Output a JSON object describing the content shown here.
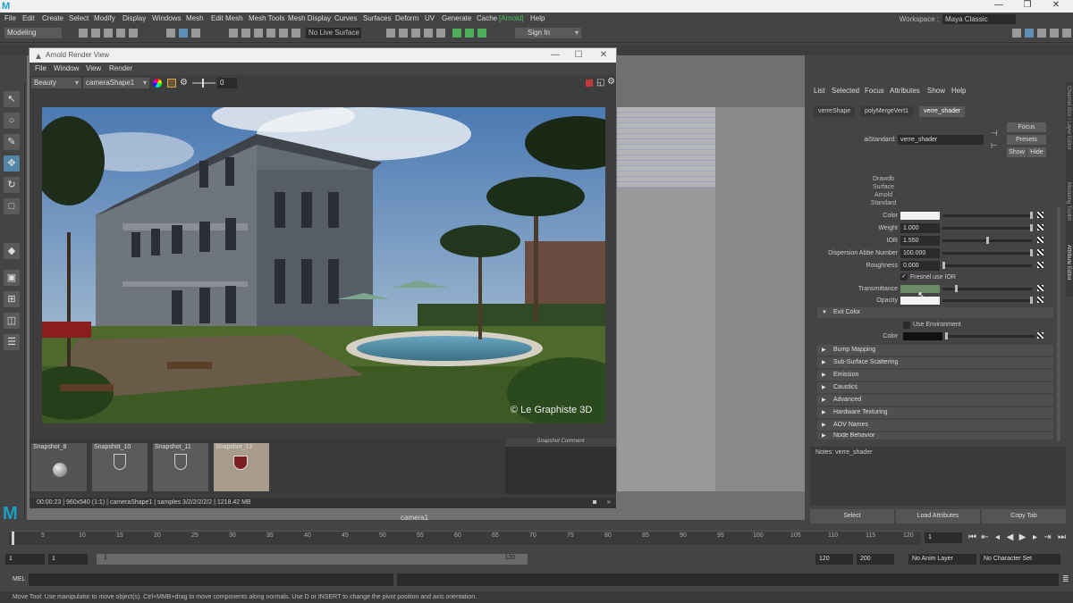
{
  "app": {
    "logo": "M",
    "workspace_label": "Workspace :",
    "workspace": "Maya Classic"
  },
  "menubar": [
    "File",
    "Edit",
    "Create",
    "Select",
    "Modify",
    "Display",
    "Windows",
    "Mesh",
    "Edit Mesh",
    "Mesh Tools",
    "Mesh Display",
    "Curves",
    "Surfaces",
    "Deform",
    "UV",
    "Generate",
    "Cache",
    "[Arnold]",
    "Help"
  ],
  "statusline": {
    "mode": "Modeling",
    "live_surface": "No Live Surface",
    "signin": "Sign In"
  },
  "viewport": {
    "camera_label": "camera1"
  },
  "arnold": {
    "title": "Arnold Render View",
    "menus": [
      "File",
      "Window",
      "View",
      "Render"
    ],
    "aov": "Beauty",
    "camera": "cameraShape1",
    "exposure": "0",
    "watermark": "© Le Graphiste 3D",
    "snapshots": [
      "Snapshot_8",
      "Snapshot_10",
      "Snapshot_11",
      "Snapshot_13"
    ],
    "snapshot_comment": "Snapshot Comment",
    "status": "00:00:23 | 960x540 (1:1) | cameraShape1 | samples 3/2/2/2/2/2 | 1218.42 MB"
  },
  "attr_editor": {
    "menus": [
      "List",
      "Selected",
      "Focus",
      "Attributes",
      "Show",
      "Help"
    ],
    "tabs": [
      "verreShape",
      "polyMergeVert1",
      "verre_shader"
    ],
    "node_type_label": "aiStandard:",
    "node_name": "verre_shader",
    "btn_focus": "Focus",
    "btn_presets": "Presets",
    "btn_show": "Show",
    "btn_hide": "Hide",
    "swatch_label": [
      "Drawdb",
      "Surface",
      "Arnold",
      "Standard"
    ],
    "color_label": "Color",
    "weight_label": "Weight",
    "weight_value": "1.000",
    "ior_label": "IOR",
    "ior_value": "1.550",
    "abbe_label": "Dispersion Abbe Number",
    "abbe_value": "100.000",
    "roughness_label": "Roughness",
    "roughness_value": "0.000",
    "fresnel_label": "Fresnel use IOR",
    "transmittance_label": "Transmittance",
    "opacity_label": "Opacity",
    "exit_color_section": "Exit Color",
    "use_env_label": "Use Environment",
    "exit_color_label": "Color",
    "sections": [
      "Bump Mapping",
      "Sub-Surface Scattering",
      "Emission",
      "Caustics",
      "Advanced",
      "Hardware Texturing",
      "AOV Names",
      "Node Behavior"
    ],
    "notes_label": "Notes:  verre_shader",
    "btn_select": "Select",
    "btn_load": "Load Attributes",
    "btn_copy": "Copy Tab"
  },
  "side_labels": [
    "Channel Box / Layer Editor",
    "Modeling Toolkit",
    "Attribute Editor"
  ],
  "timeline": {
    "ticks": [
      "5",
      "10",
      "15",
      "20",
      "25",
      "30",
      "35",
      "40",
      "45",
      "50",
      "55",
      "60",
      "65",
      "70",
      "75",
      "80",
      "85",
      "90",
      "95",
      "100",
      "105",
      "110",
      "115",
      "120"
    ],
    "current_frame": "1"
  },
  "range": {
    "start": "1",
    "start2": "1",
    "slider_start": "1",
    "slider_end": "120",
    "end": "120",
    "end2": "200",
    "anim_layer": "No Anim Layer",
    "character_set": "No Character Set"
  },
  "cmdline": {
    "lang": "MEL"
  },
  "help_line": "Move Tool: Use manipulator to move object(s). Ctrl+MMB+drag to move components along normals. Use D or INSERT to change the pivot position and axis orientation."
}
